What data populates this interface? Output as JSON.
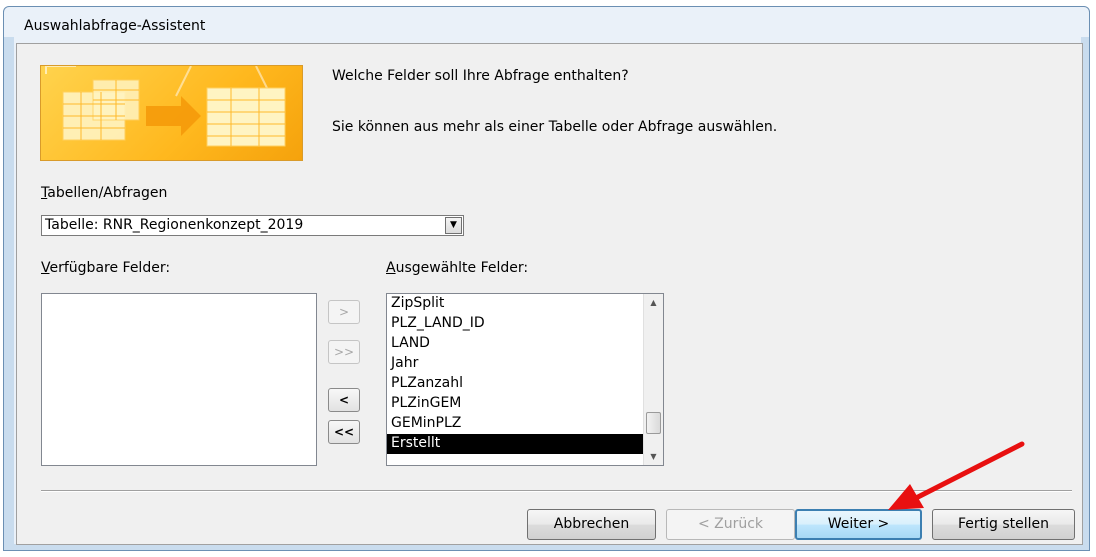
{
  "window": {
    "title": "Auswahlabfrage-Assistent"
  },
  "prompt": {
    "question": "Welche Felder soll Ihre Abfrage enthalten?",
    "hint": "Sie können aus mehr als einer Tabelle oder Abfrage auswählen."
  },
  "tables_label": {
    "accel": "T",
    "rest": "abellen/Abfragen"
  },
  "tables_combo": {
    "value": "Tabelle: RNR_Regionenkonzept_2019"
  },
  "available_label": {
    "accel": "V",
    "rest": "erfügbare Felder:"
  },
  "selected_label": {
    "accel": "A",
    "rest": "usgewählte Felder:"
  },
  "selected_fields": [
    "ZipSplit",
    "PLZ_LAND_ID",
    "LAND",
    "Jahr",
    "PLZanzahl",
    "PLZinGEM",
    "GEMinPLZ",
    "Erstellt"
  ],
  "selected_field_active": "Erstellt",
  "move_buttons": {
    "add_one": ">",
    "add_all": ">>",
    "remove_one": "<",
    "remove_all": "<<"
  },
  "buttons": {
    "cancel": "Abbrechen",
    "back": "< Zurück",
    "next": "Weiter >",
    "finish": "Fertig stellen"
  },
  "colors": {
    "annotation_arrow": "#e81010",
    "default_button_border": "#3c7fb1",
    "selection": "#000000"
  }
}
